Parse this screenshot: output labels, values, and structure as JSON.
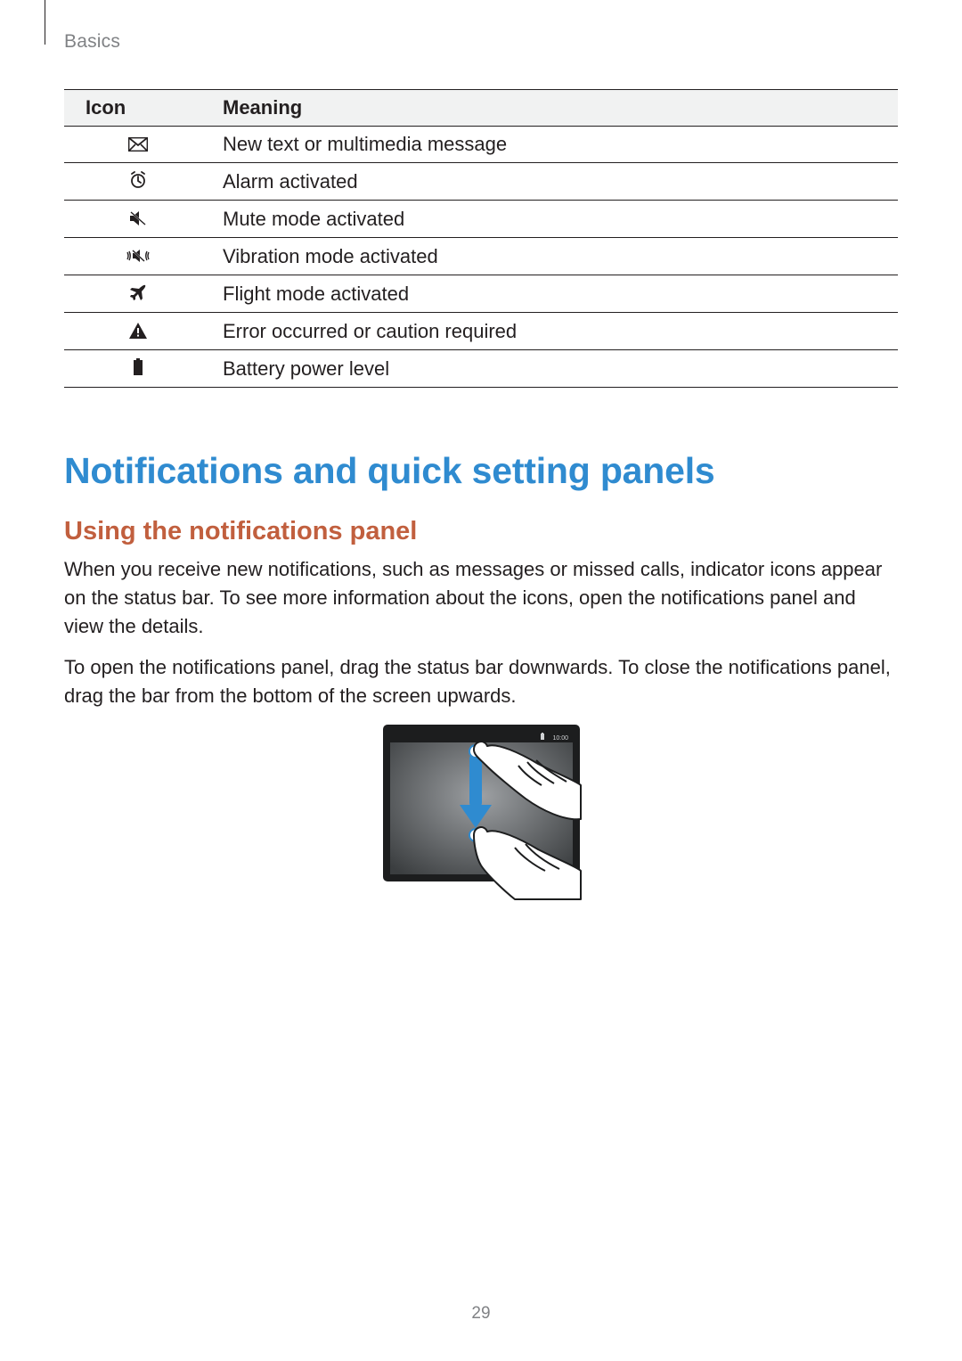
{
  "section_label": "Basics",
  "page_number": "29",
  "table": {
    "headers": {
      "icon": "Icon",
      "meaning": "Meaning"
    },
    "rows": [
      {
        "icon_name": "message-icon",
        "meaning": "New text or multimedia message"
      },
      {
        "icon_name": "alarm-icon",
        "meaning": "Alarm activated"
      },
      {
        "icon_name": "mute-icon",
        "meaning": "Mute mode activated"
      },
      {
        "icon_name": "vibrate-icon",
        "meaning": "Vibration mode activated"
      },
      {
        "icon_name": "flight-icon",
        "meaning": "Flight mode activated"
      },
      {
        "icon_name": "warning-icon",
        "meaning": "Error occurred or caution required"
      },
      {
        "icon_name": "battery-icon",
        "meaning": "Battery power level"
      }
    ]
  },
  "heading_main": "Notifications and quick setting panels",
  "heading_sub": "Using the notifications panel",
  "paragraph_1": "When you receive new notifications, such as messages or missed calls, indicator icons appear on the status bar. To see more information about the icons, open the notifications panel and view the details.",
  "paragraph_2": "To open the notifications panel, drag the status bar downwards. To close the notifications panel, drag the bar from the bottom of the screen upwards.",
  "illustration": {
    "status_time": "10:00"
  }
}
